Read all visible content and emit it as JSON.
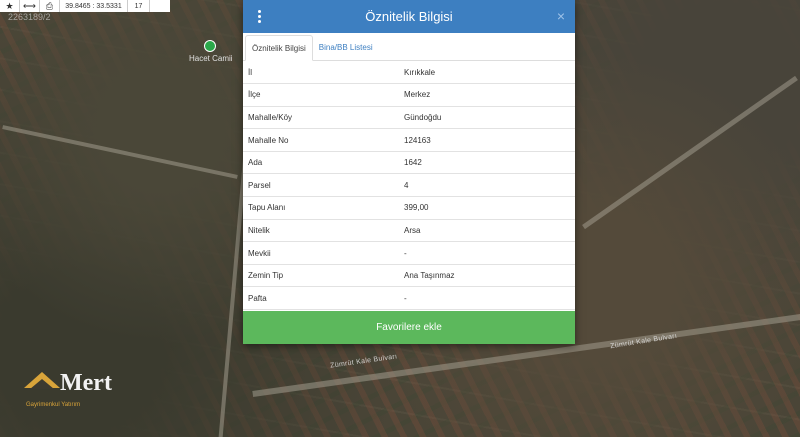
{
  "toolbar": {
    "star_icon": "star-icon",
    "measure_icon": "ruler-icon",
    "print_icon": "print-icon",
    "coordinates": "39.8465 : 33.5331",
    "zoom": "17"
  },
  "map": {
    "coordinate_overlay": "2263189/2",
    "poi_label": "Hacet Camii",
    "road_labels": [
      "Zümrüt Kale Bulvarı",
      "Zümrüt Kale Bulvarı"
    ]
  },
  "logo": {
    "word": "Mert",
    "subtitle": "Gayrimenkul Yatırım"
  },
  "dialog": {
    "title": "Öznitelik Bilgisi",
    "close_label": "×",
    "tabs": [
      {
        "label": "Öznitelik Bilgisi",
        "active": true
      },
      {
        "label": "Bina/BB Listesi",
        "active": false
      }
    ],
    "rows": [
      {
        "key": "İl",
        "value": "Kırıkkale"
      },
      {
        "key": "İlçe",
        "value": "Merkez"
      },
      {
        "key": "Mahalle/Köy",
        "value": "Gündoğdu"
      },
      {
        "key": "Mahalle No",
        "value": "124163"
      },
      {
        "key": "Ada",
        "value": "1642"
      },
      {
        "key": "Parsel",
        "value": "4"
      },
      {
        "key": "Tapu Alanı",
        "value": "399,00"
      },
      {
        "key": "Nitelik",
        "value": "Arsa"
      },
      {
        "key": "Mevkii",
        "value": "-"
      },
      {
        "key": "Zemin Tip",
        "value": "Ana Taşınmaz"
      },
      {
        "key": "Pafta",
        "value": "-"
      }
    ],
    "favorite_button": "Favorilere ekle"
  },
  "colors": {
    "header_blue": "#3d7fc1",
    "button_green": "#5cb85c"
  }
}
